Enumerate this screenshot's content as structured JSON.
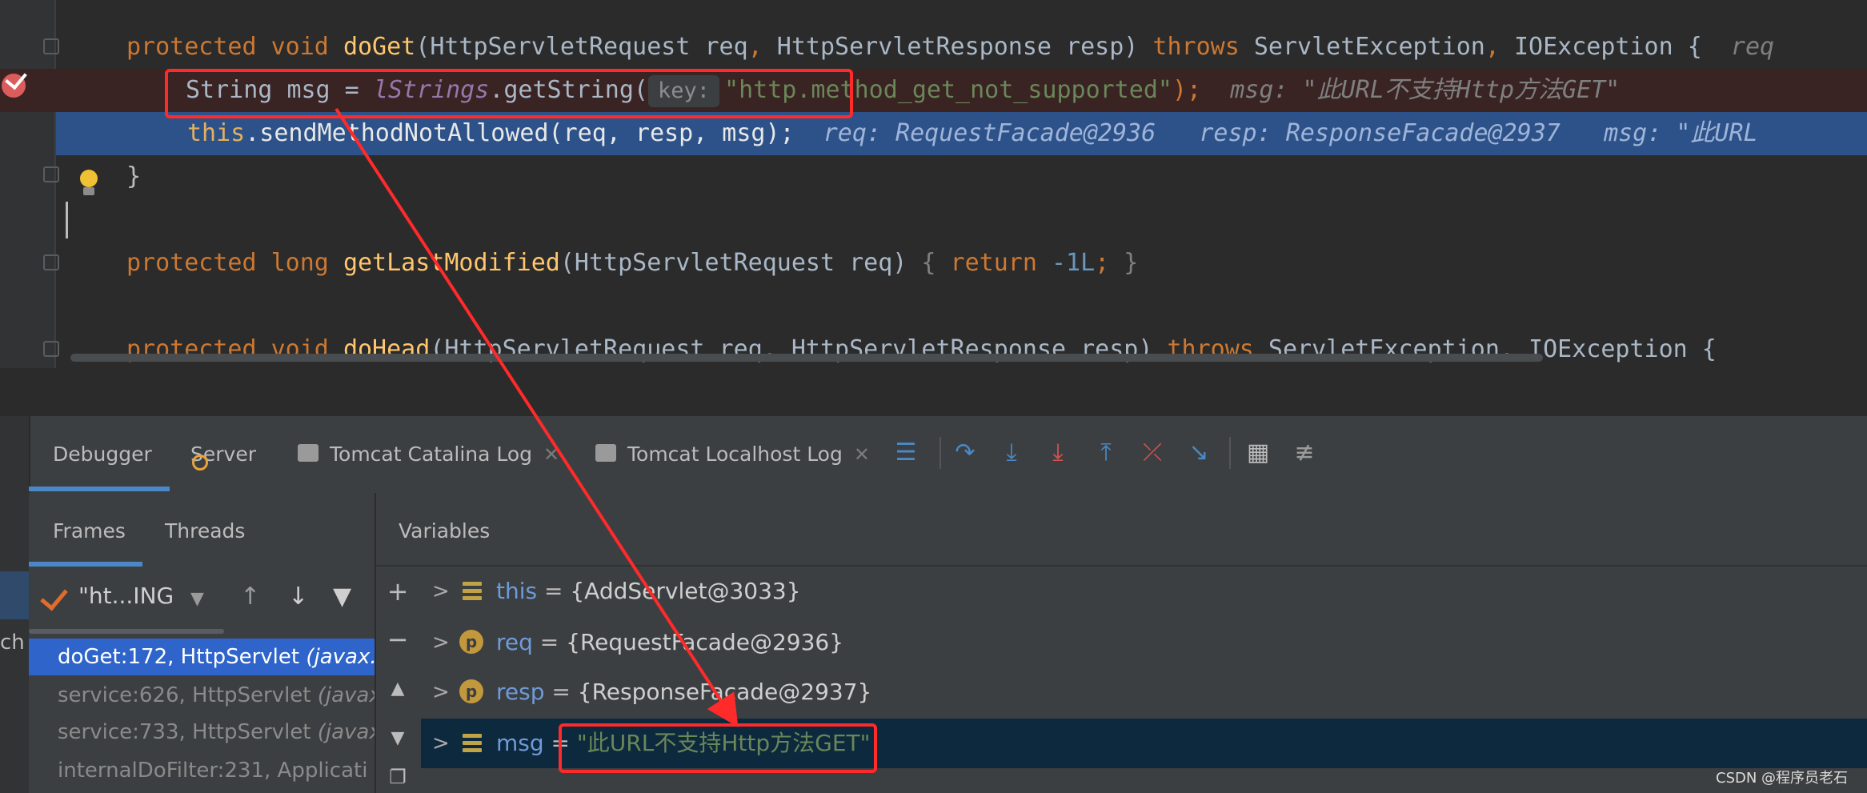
{
  "editor": {
    "lines": {
      "doget_signature": {
        "kw1": "protected",
        "kw2": "void",
        "name": "doGet",
        "open": "(",
        "t1": "HttpServletRequest",
        "p1": "req",
        "comma1": ", ",
        "t2": "HttpServletResponse",
        "p2": "resp",
        "close": ") ",
        "throws": "throws",
        "e1": "ServletException",
        "comma2": ", ",
        "e2": "IOException",
        "brace": " {",
        "hint": "req"
      },
      "msg_line": {
        "type": "String",
        "var": "msg",
        "eq": " = ",
        "static": "lStrings",
        "call": ".getString(",
        "param_name": "key:",
        "string": "\"http.method_get_not_supported\"",
        "end": ");",
        "hint": "msg: \"此URL不支持Http方法GET\""
      },
      "exec_line": {
        "this": "this",
        "call": ".sendMethodNotAllowed(req, resp, msg);",
        "hint_req": "req: RequestFacade@2936",
        "hint_resp": "resp: ResponseFacade@2937",
        "hint_msg": "msg: \"此URL"
      },
      "close_brace": "}",
      "getlastmodified": {
        "kw1": "protected",
        "kw2": "long",
        "name": "getLastModified",
        "args": "(HttpServletRequest req)",
        "open": " { ",
        "ret": "return",
        "num": "-1L",
        "semi": ";",
        "close": " }"
      },
      "dohead_signature": {
        "kw1": "protected",
        "kw2": "void",
        "name": "doHead",
        "open": "(",
        "t1": "HttpServletRequest",
        "p1": "req",
        "comma1": ", ",
        "t2": "HttpServletResponse",
        "p2": "resp",
        "close": ") ",
        "throws": "throws",
        "e1": "ServletException",
        "comma2": ", ",
        "e2": "IOException",
        "brace": " {"
      }
    }
  },
  "debugger": {
    "tabs": {
      "debugger": "Debugger",
      "server": "Server",
      "catalina": "Tomcat Catalina Log",
      "localhost": "Tomcat Localhost Log"
    },
    "subtabs": {
      "frames": "Frames",
      "threads": "Threads",
      "variables": "Variables"
    },
    "thread_selector": "\"ht...ING",
    "left_strip_label": "ch",
    "frames": [
      {
        "method": "doGet:172, HttpServlet ",
        "pkg": "(javax.s"
      },
      {
        "method": "service:626, HttpServlet ",
        "pkg": "(javax."
      },
      {
        "method": "service:733, HttpServlet ",
        "pkg": "(javax."
      },
      {
        "method": "internalDoFilter:231, Applicati",
        "pkg": ""
      }
    ],
    "variables": [
      {
        "name": "this",
        "eq": " = ",
        "value": "{AddServlet@3033}"
      },
      {
        "name": "req",
        "eq": " = ",
        "value": "{RequestFacade@2936}"
      },
      {
        "name": "resp",
        "eq": " = ",
        "value": "{ResponseFacade@2937}"
      },
      {
        "name": "msg",
        "eq": " = ",
        "value": "\"此URL不支持Http方法GET\""
      }
    ]
  },
  "watermark": "CSDN @程序员老石",
  "colors": {
    "annotation": "#ff2a2a",
    "exec_line": "#2d5289",
    "selected_frame": "#2f65ca"
  }
}
